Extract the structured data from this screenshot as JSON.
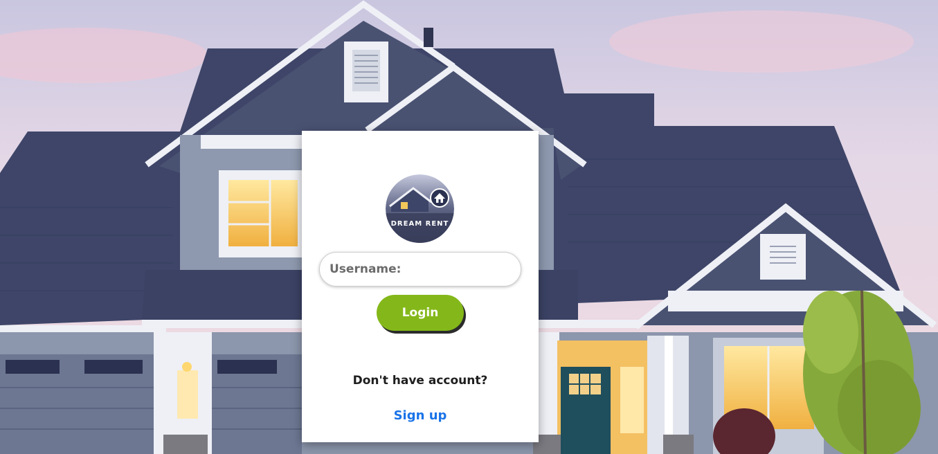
{
  "background": {
    "description_icon": "house-background-image",
    "sky_color": "#d9d3e6",
    "roof_color": "#3d4466",
    "siding_color": "#8791a8",
    "window_light": "#f2c75a"
  },
  "login_card": {
    "logo": {
      "icon": "house-logo-icon",
      "text": "DREAM RENT"
    },
    "username": {
      "placeholder": "Username:",
      "value": ""
    },
    "login_button": {
      "label": "Login",
      "color": "#84b81a"
    },
    "no_account_text": "Don't have account?",
    "signup_link": {
      "label": "Sign up",
      "color": "#1a73e8"
    }
  }
}
